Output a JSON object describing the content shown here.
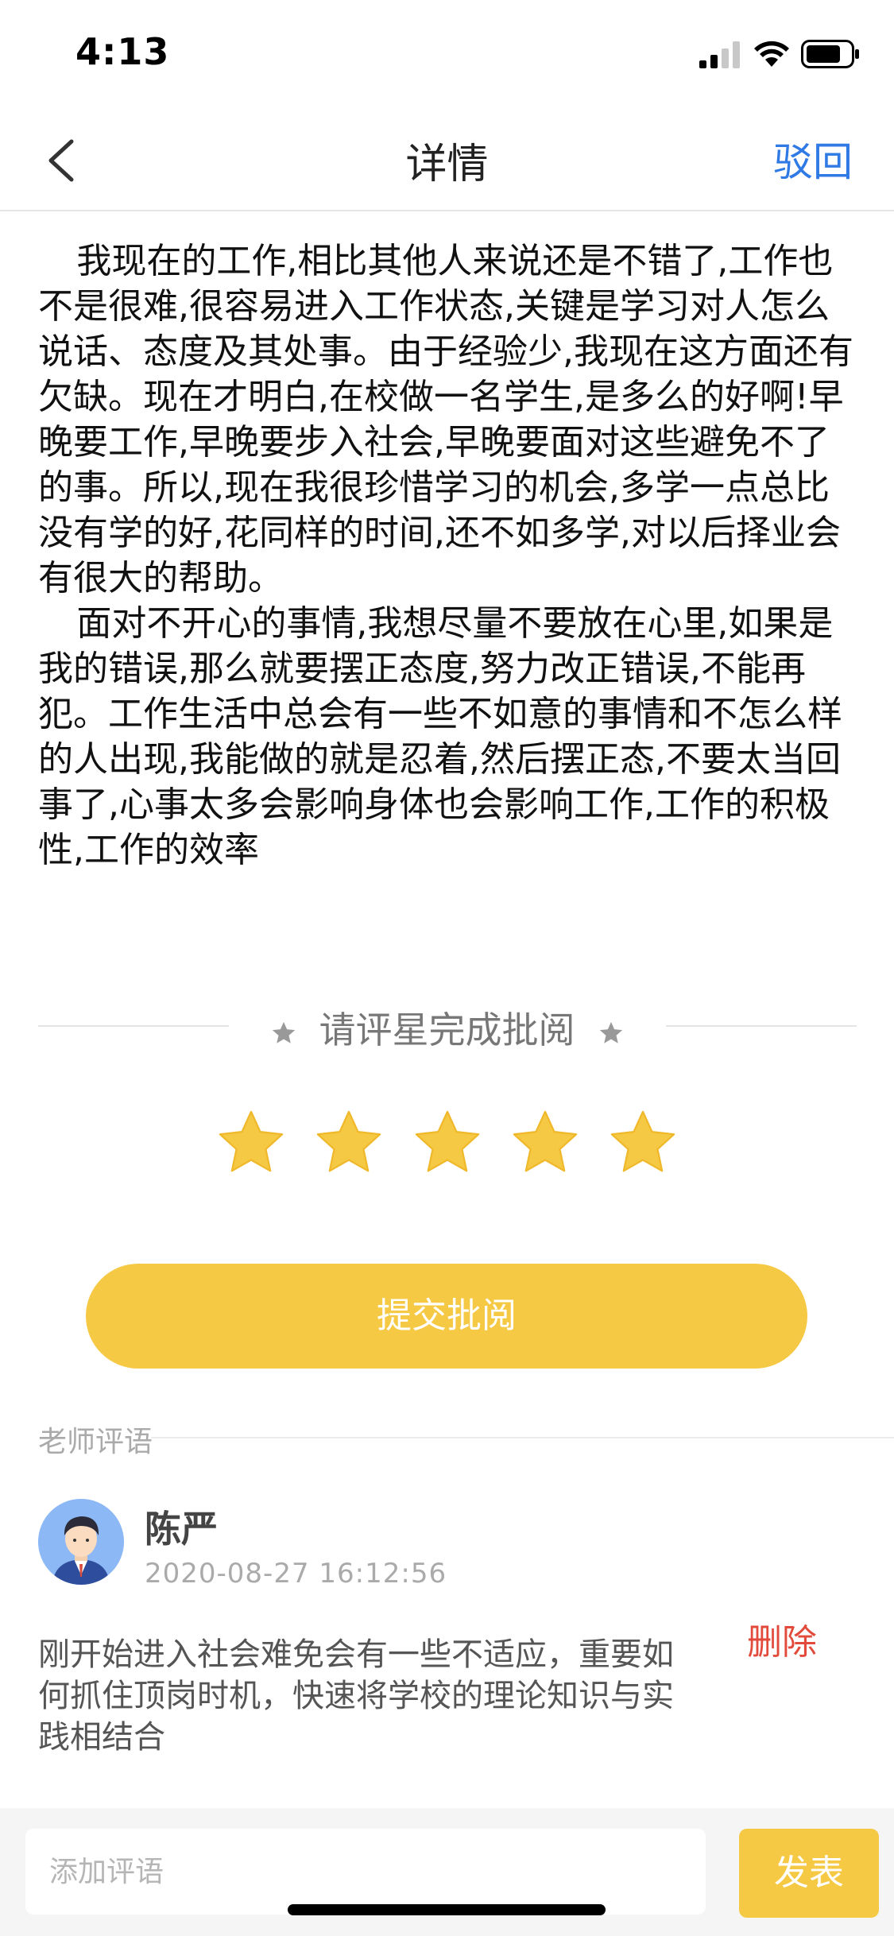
{
  "status_bar": {
    "time": "4:13"
  },
  "nav": {
    "title": "详情",
    "reject_label": "驳回"
  },
  "article": {
    "paragraphs": [
      "我现在的工作,相比其他人来说还是不错了,工作也不是很难,很容易进入工作状态,关键是学习对人怎么说话、态度及其处事。由于经验少,我现在这方面还有欠缺。现在才明白,在校做一名学生,是多么的好啊!早晚要工作,早晚要步入社会,早晚要面对这些避免不了的事。所以,现在我很珍惜学习的机会,多学一点总比没有学的好,花同样的时间,还不如多学,对以后择业会有很大的帮助。",
      "面对不开心的事情,我想尽量不要放在心里,如果是我的错误,那么就要摆正态度,努力改正错误,不能再犯。工作生活中总会有一些不如意的事情和不怎么样的人出现,我能做的就是忍着,然后摆正态,不要太当回事了,心事太多会影响身体也会影响工作,工作的积极性,工作的效率"
    ]
  },
  "rating": {
    "prompt": "请评星完成批阅",
    "stars_selected": 5,
    "stars_total": 5,
    "star_color": "#f6c944"
  },
  "submit": {
    "label": "提交批阅",
    "color": "#f6c944"
  },
  "comments": {
    "section_label": "老师评语",
    "items": [
      {
        "teacher": "陈严",
        "time": "2020-08-27 16:12:56",
        "text": "刚开始进入社会难免会有一些不适应，重要如何抓住顶岗时机，快速将学校的理论知识与实践相结合",
        "delete_label": "删除"
      }
    ]
  },
  "input_bar": {
    "placeholder": "添加评语",
    "publish_label": "发表"
  },
  "colors": {
    "accent": "#f6c944",
    "link": "#2f7ae5",
    "danger": "#e24a3b"
  }
}
